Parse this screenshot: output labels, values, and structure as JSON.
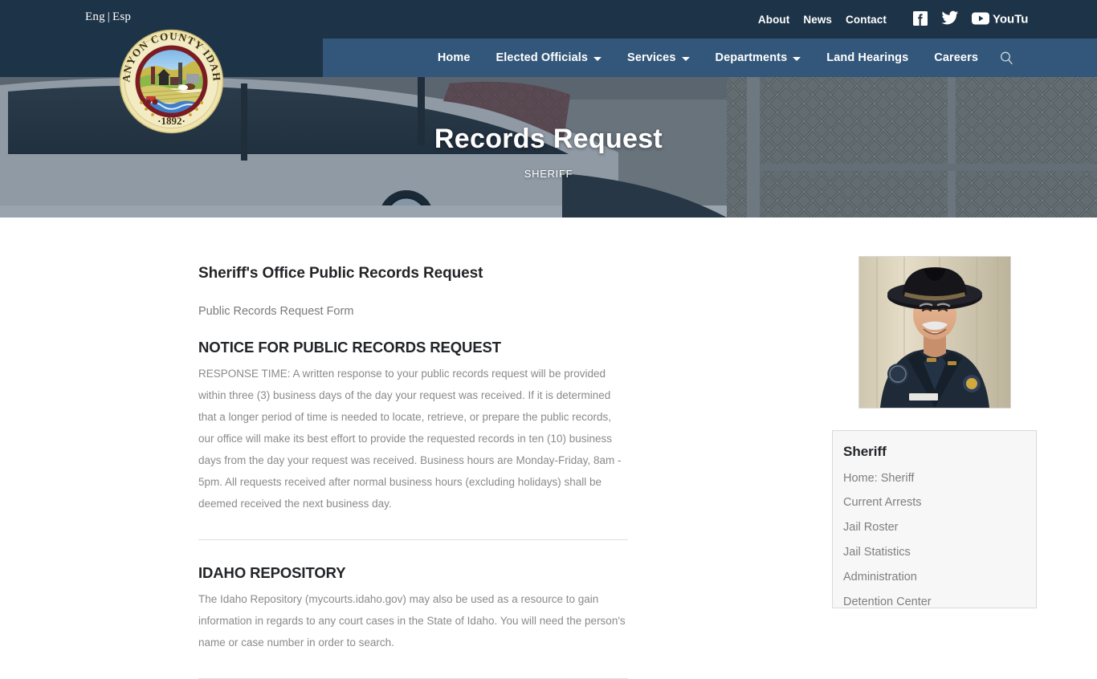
{
  "header": {
    "language": {
      "eng": "Eng",
      "separator": "|",
      "esp": "Esp"
    },
    "utility_links": [
      "About",
      "News",
      "Contact"
    ],
    "social": [
      {
        "name": "facebook-icon",
        "label": "Facebook"
      },
      {
        "name": "twitter-icon",
        "label": "Twitter"
      },
      {
        "name": "youtube-icon",
        "label": "YouTube"
      }
    ],
    "logo_alt": "Canyon County Idaho 1892",
    "logo_text": {
      "ring": "CANYON COUNTY IDAHO",
      "year": "·1892·"
    },
    "bg_color": "#1d3347"
  },
  "nav": {
    "bg_color": "#33577a",
    "items": [
      {
        "label": "Home",
        "has_dropdown": false
      },
      {
        "label": "Elected Officials",
        "has_dropdown": true
      },
      {
        "label": "Services",
        "has_dropdown": true
      },
      {
        "label": "Departments",
        "has_dropdown": true
      },
      {
        "label": "Land Hearings",
        "has_dropdown": false
      },
      {
        "label": "Careers",
        "has_dropdown": false
      }
    ],
    "search_icon": "search-icon"
  },
  "hero": {
    "title": "Records Request",
    "subtitle": "SHERIFF",
    "image_description": "police vehicle in front of chain link fence"
  },
  "main": {
    "heading": "Sheriff's Office Public Records Request",
    "lead": "Public Records Request Form",
    "sections": [
      {
        "heading": "NOTICE FOR PUBLIC RECORDS REQUEST",
        "body": "RESPONSE TIME: A written response to your public records request will be provided within three (3) business days of the day your request was received. If it is determined that a longer period of time is needed to locate, retrieve, or prepare the public records, our office will make its best effort to provide the requested records in ten (10) business days from the day your request was received. Business hours are Monday-Friday, 8am - 5pm. All requests received after normal business hours (excluding holidays) shall be deemed received the next business day."
      },
      {
        "heading": "IDAHO REPOSITORY",
        "body": "The Idaho Repository (mycourts.idaho.gov) may also be used as a resource to gain information in regards to any court cases in the State of Idaho. You will need the person's name or case number in order to search."
      }
    ]
  },
  "sidebar": {
    "portrait_alt": "Sheriff portrait",
    "card_title": "Sheriff",
    "links": [
      "Home: Sheriff",
      "Current Arrests",
      "Jail Roster",
      "Jail Statistics",
      "Administration",
      "Detention Center"
    ]
  }
}
